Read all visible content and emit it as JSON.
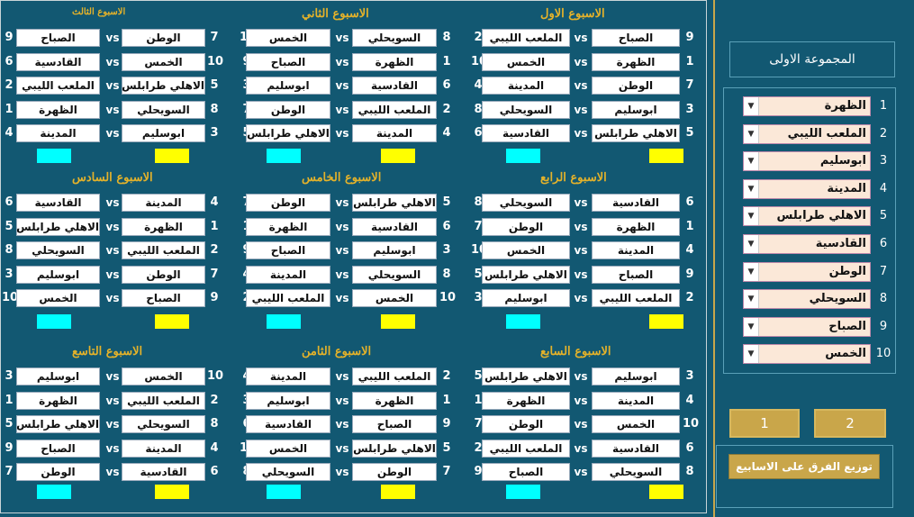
{
  "vs_label": "vs",
  "colors": {
    "cyan": "#00ffff",
    "yellow": "#ffff00"
  },
  "weeks": [
    {
      "title": "الاسبوع الاول",
      "rows": [
        {
          "ln": "9",
          "lt": "الصباح",
          "rn": "2",
          "rt": "الملعب الليبي"
        },
        {
          "ln": "1",
          "lt": "الظهرة",
          "rn": "10",
          "rt": "الخمس"
        },
        {
          "ln": "7",
          "lt": "الوطن",
          "rn": "4",
          "rt": "المدينة"
        },
        {
          "ln": "3",
          "lt": "ابوسليم",
          "rn": "8",
          "rt": "السويحلي"
        },
        {
          "ln": "5",
          "lt": "الاهلي طرابلس",
          "rn": "6",
          "rt": "القادسية"
        }
      ]
    },
    {
      "title": "الاسبوع الثاني",
      "rows": [
        {
          "ln": "8",
          "lt": "السويحلي",
          "rn": "10",
          "rt": "الخمس"
        },
        {
          "ln": "1",
          "lt": "الظهرة",
          "rn": "9",
          "rt": "الصباح"
        },
        {
          "ln": "6",
          "lt": "القادسية",
          "rn": "3",
          "rt": "ابوسليم"
        },
        {
          "ln": "2",
          "lt": "الملعب الليبي",
          "rn": "7",
          "rt": "الوطن"
        },
        {
          "ln": "4",
          "lt": "المدينة",
          "rn": "5",
          "rt": "الاهلي طرابلس"
        }
      ]
    },
    {
      "title": "الاسبوع الثالث",
      "rows": [
        {
          "ln": "7",
          "lt": "الوطن",
          "rn": "9",
          "rt": "الصباح"
        },
        {
          "ln": "10",
          "lt": "الخمس",
          "rn": "6",
          "rt": "القادسية"
        },
        {
          "ln": "5",
          "lt": "الاهلي طرابلس",
          "rn": "2",
          "rt": "الملعب الليبي"
        },
        {
          "ln": "8",
          "lt": "السويحلي",
          "rn": "1",
          "rt": "الظهرة"
        },
        {
          "ln": "3",
          "lt": "ابوسليم",
          "rn": "4",
          "rt": "المدينة"
        }
      ]
    },
    {
      "title": "الاسبوع الرابع",
      "rows": [
        {
          "ln": "6",
          "lt": "القادسية",
          "rn": "8",
          "rt": "السويحلي"
        },
        {
          "ln": "1",
          "lt": "الظهرة",
          "rn": "7",
          "rt": "الوطن"
        },
        {
          "ln": "4",
          "lt": "المدينة",
          "rn": "10",
          "rt": "الخمس"
        },
        {
          "ln": "9",
          "lt": "الصباح",
          "rn": "5",
          "rt": "الاهلي طرابلس"
        },
        {
          "ln": "2",
          "lt": "الملعب الليبي",
          "rn": "3",
          "rt": "ابوسليم"
        }
      ]
    },
    {
      "title": "الاسبوع الخامس",
      "rows": [
        {
          "ln": "5",
          "lt": "الاهلي طرابلس",
          "rn": "7",
          "rt": "الوطن"
        },
        {
          "ln": "6",
          "lt": "القادسية",
          "rn": "1",
          "rt": "الظهرة"
        },
        {
          "ln": "3",
          "lt": "ابوسليم",
          "rn": "9",
          "rt": "الصباح"
        },
        {
          "ln": "8",
          "lt": "السويحلي",
          "rn": "4",
          "rt": "المدينة"
        },
        {
          "ln": "10",
          "lt": "الخمس",
          "rn": "2",
          "rt": "الملعب الليبي"
        }
      ]
    },
    {
      "title": "الاسبوع السادس",
      "rows": [
        {
          "ln": "4",
          "lt": "المدينة",
          "rn": "6",
          "rt": "القادسية"
        },
        {
          "ln": "1",
          "lt": "الظهرة",
          "rn": "5",
          "rt": "الاهلي طرابلس"
        },
        {
          "ln": "2",
          "lt": "الملعب الليبي",
          "rn": "8",
          "rt": "السويحلي"
        },
        {
          "ln": "7",
          "lt": "الوطن",
          "rn": "3",
          "rt": "ابوسليم"
        },
        {
          "ln": "9",
          "lt": "الصباح",
          "rn": "10",
          "rt": "الخمس"
        }
      ]
    },
    {
      "title": "الاسبوع السابع",
      "rows": [
        {
          "ln": "3",
          "lt": "ابوسليم",
          "rn": "5",
          "rt": "الاهلي طرابلس"
        },
        {
          "ln": "4",
          "lt": "المدينة",
          "rn": "1",
          "rt": "الظهرة"
        },
        {
          "ln": "10",
          "lt": "الخمس",
          "rn": "7",
          "rt": "الوطن"
        },
        {
          "ln": "6",
          "lt": "القادسية",
          "rn": "2",
          "rt": "الملعب الليبي"
        },
        {
          "ln": "8",
          "lt": "السويحلي",
          "rn": "9",
          "rt": "الصباح"
        }
      ]
    },
    {
      "title": "الاسبوع الثامن",
      "rows": [
        {
          "ln": "2",
          "lt": "الملعب الليبي",
          "rn": "4",
          "rt": "المدينة"
        },
        {
          "ln": "1",
          "lt": "الظهرة",
          "rn": "3",
          "rt": "ابوسليم"
        },
        {
          "ln": "9",
          "lt": "الصباح",
          "rn": "6",
          "rt": "القادسية"
        },
        {
          "ln": "5",
          "lt": "الاهلي طرابلس",
          "rn": "10",
          "rt": "الخمس"
        },
        {
          "ln": "7",
          "lt": "الوطن",
          "rn": "8",
          "rt": "السويحلي"
        }
      ]
    },
    {
      "title": "الاسبوع التاسع",
      "rows": [
        {
          "ln": "10",
          "lt": "الخمس",
          "rn": "3",
          "rt": "ابوسليم"
        },
        {
          "ln": "2",
          "lt": "الملعب الليبي",
          "rn": "1",
          "rt": "الظهرة"
        },
        {
          "ln": "8",
          "lt": "السويحلي",
          "rn": "5",
          "rt": "الاهلي طرابلس"
        },
        {
          "ln": "4",
          "lt": "المدينة",
          "rn": "9",
          "rt": "الصباح"
        },
        {
          "ln": "6",
          "lt": "القادسية",
          "rn": "7",
          "rt": "الوطن"
        }
      ]
    }
  ],
  "group": {
    "title": "المجموعة الاولى",
    "teams": [
      {
        "num": "1",
        "name": "الظهرة"
      },
      {
        "num": "2",
        "name": "الملعب الليبي"
      },
      {
        "num": "3",
        "name": "ابوسليم"
      },
      {
        "num": "4",
        "name": "المدينة"
      },
      {
        "num": "5",
        "name": "الاهلي طرابلس"
      },
      {
        "num": "6",
        "name": "القادسية"
      },
      {
        "num": "7",
        "name": "الوطن"
      },
      {
        "num": "8",
        "name": "السويحلي"
      },
      {
        "num": "9",
        "name": "الصباح"
      },
      {
        "num": "10",
        "name": "الخمس"
      }
    ],
    "dropdown_arrow": "▼",
    "group_buttons": [
      "1",
      "2"
    ],
    "distribute_label": "توزيع الفرق على الاسابيع"
  }
}
